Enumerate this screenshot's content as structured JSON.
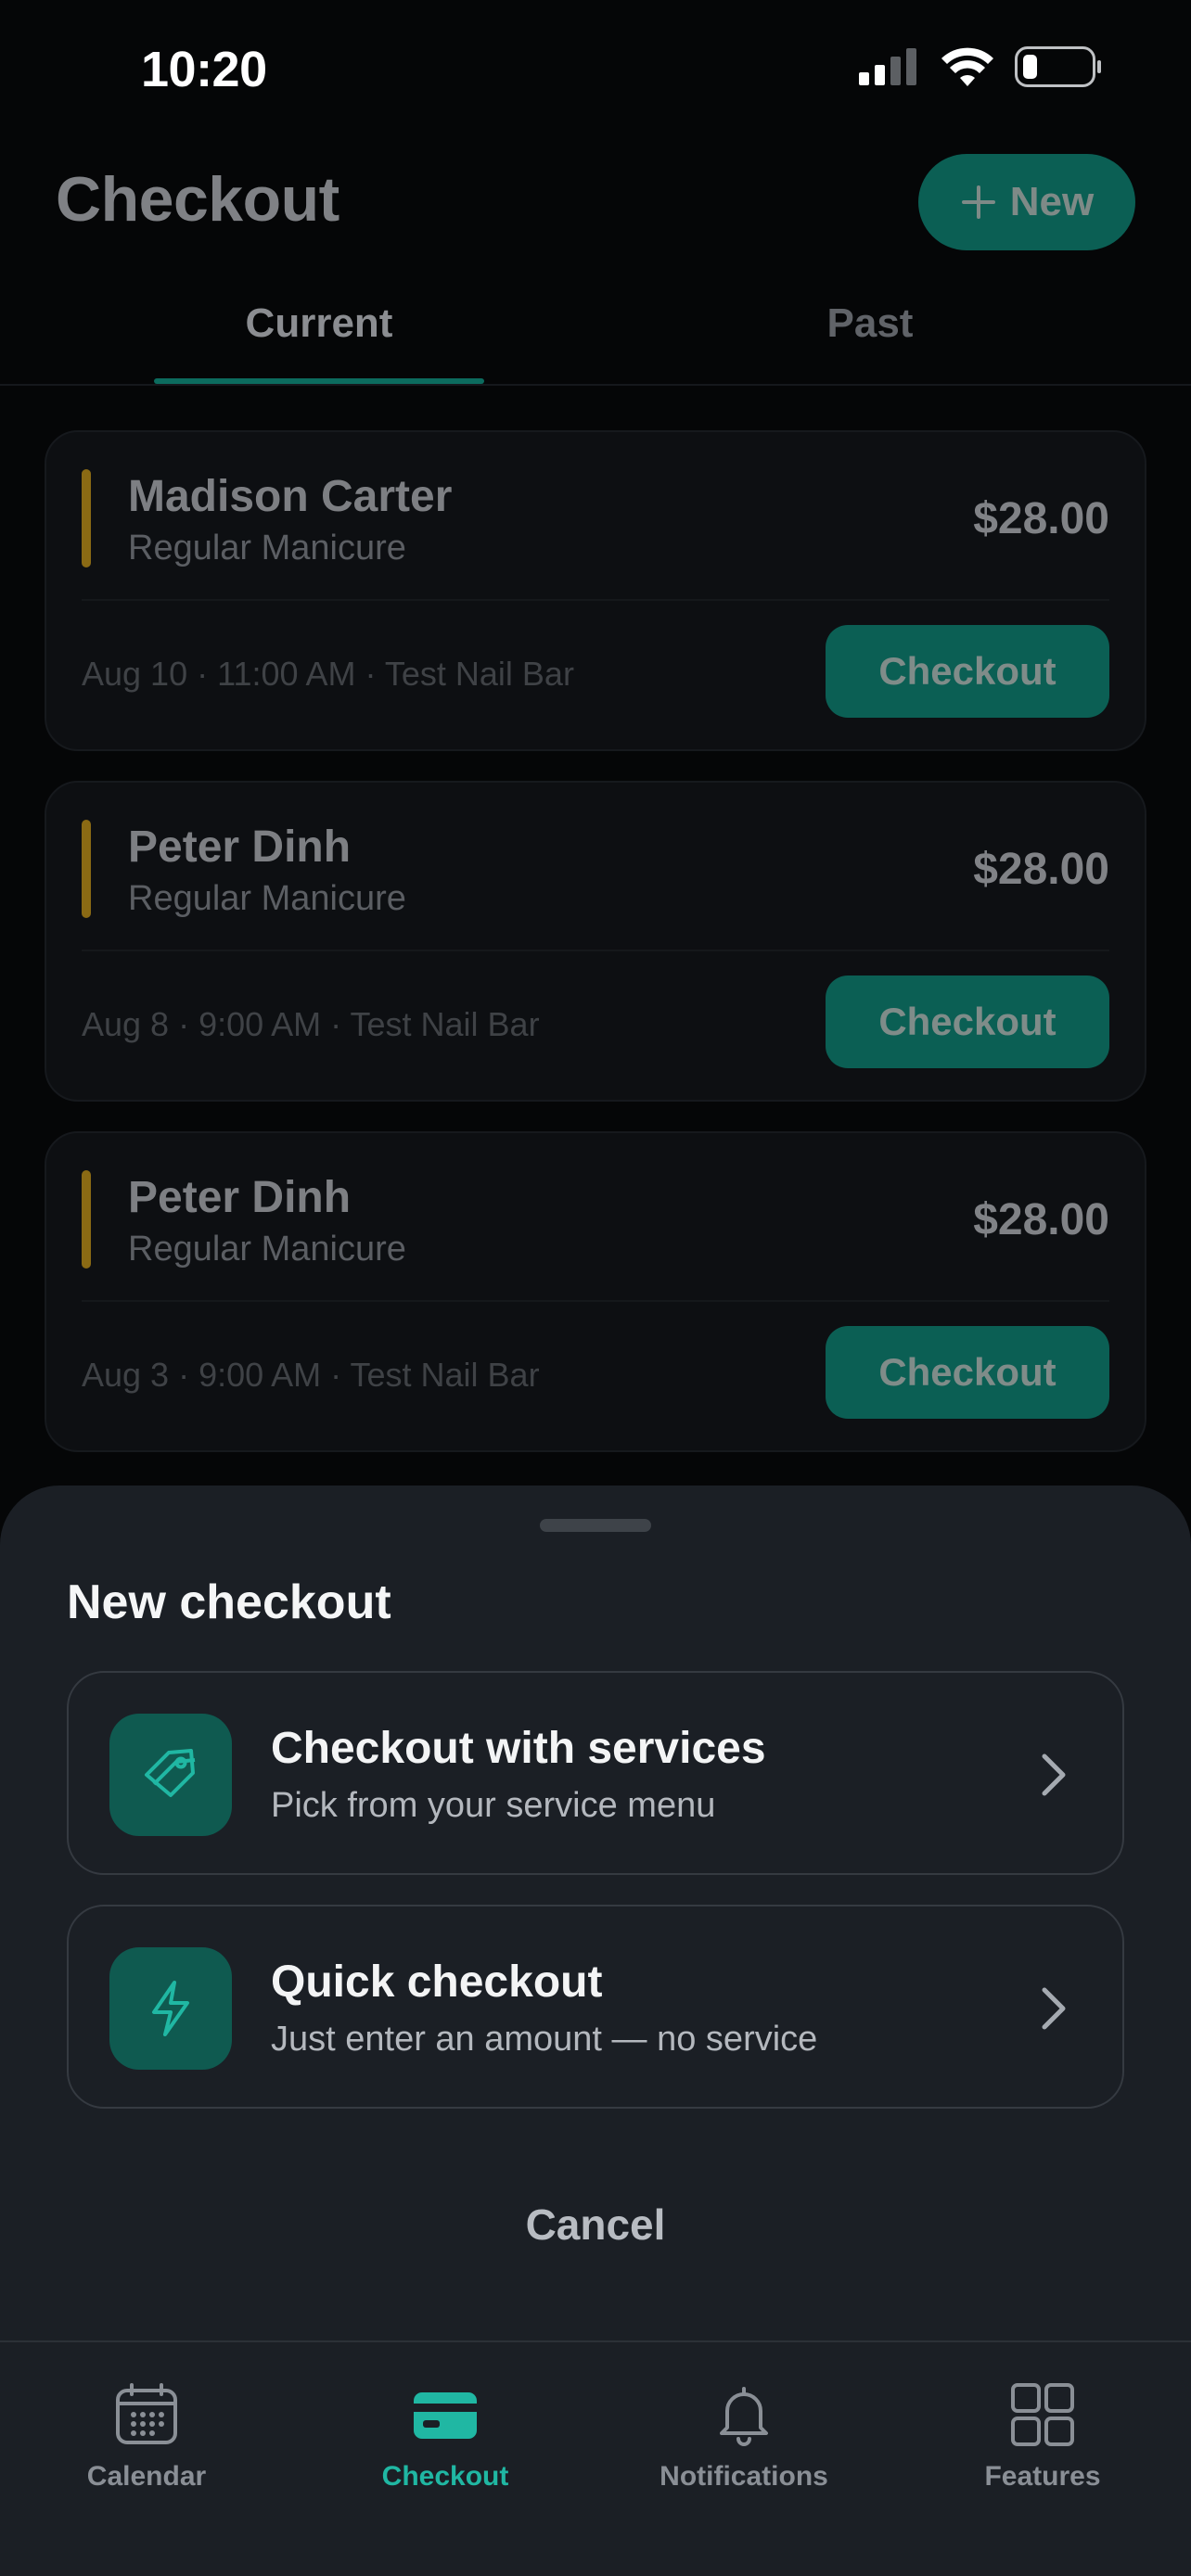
{
  "status_bar": {
    "time": "10:20"
  },
  "header": {
    "title": "Checkout",
    "new_button": "New"
  },
  "tabs": [
    {
      "label": "Current",
      "active": true
    },
    {
      "label": "Past",
      "active": false
    }
  ],
  "appointments": [
    {
      "client": "Madison Carter",
      "service": "Regular Manicure",
      "price": "$28.00",
      "meta": "Aug 10 · 11:00 AM · Test Nail Bar",
      "button": "Checkout"
    },
    {
      "client": "Peter Dinh",
      "service": "Regular Manicure",
      "price": "$28.00",
      "meta": "Aug 8 · 9:00 AM · Test Nail Bar",
      "button": "Checkout"
    },
    {
      "client": "Peter Dinh",
      "service": "Regular Manicure",
      "price": "$28.00",
      "meta": "Aug 3 · 9:00 AM · Test Nail Bar",
      "button": "Checkout"
    }
  ],
  "sheet": {
    "title": "New checkout",
    "options": [
      {
        "title": "Checkout with services",
        "subtitle": "Pick from your service menu",
        "icon": "tag-icon"
      },
      {
        "title": "Quick checkout",
        "subtitle": "Just enter an amount — no service",
        "icon": "lightning-icon"
      }
    ],
    "cancel": "Cancel"
  },
  "tab_bar": {
    "items": [
      {
        "label": "Calendar",
        "icon": "calendar-icon",
        "active": false
      },
      {
        "label": "Checkout",
        "icon": "card-icon",
        "active": true
      },
      {
        "label": "Notifications",
        "icon": "bell-icon",
        "active": false
      },
      {
        "label": "Features",
        "icon": "grid-icon",
        "active": false
      }
    ]
  },
  "colors": {
    "accent": "#20b7a3",
    "button_dim": "#0b5f54",
    "sheet_bg": "#1b1f25",
    "amber_bar": "#8a6a14"
  }
}
